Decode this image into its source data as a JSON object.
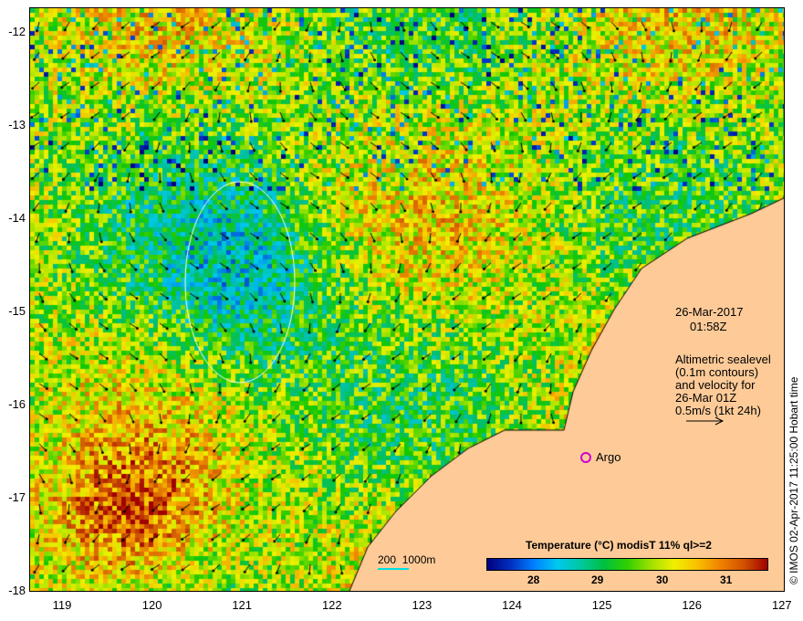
{
  "map": {
    "x_ticks": [
      "119",
      "120",
      "121",
      "122",
      "123",
      "124",
      "125",
      "126",
      "127"
    ],
    "y_ticks": [
      "-12",
      "-13",
      "-14",
      "-15",
      "-16",
      "-17",
      "-18"
    ]
  },
  "annotation": {
    "date": "26-Mar-2017",
    "time": "01:58Z",
    "line1": "Altimetric sealevel",
    "line2": "(0.1m contours)",
    "line3": "and velocity for",
    "line4": "26-Mar 01Z",
    "line5": "0.5m/s (1kt 24h)"
  },
  "argo_label": "Argo",
  "scale_label": "200  1000m",
  "colorbar": {
    "title": "Temperature (°C) modisT 11% ql>=2",
    "labels": [
      "28",
      "29",
      "30",
      "31"
    ],
    "range": [
      27.3,
      31.7
    ]
  },
  "side_text": "© IMOS 02-Apr-2017 11:25:00 Hobart time",
  "colors": {
    "land": "#fecb98",
    "argo": "#d000d0",
    "contour": "#ffffff"
  }
}
